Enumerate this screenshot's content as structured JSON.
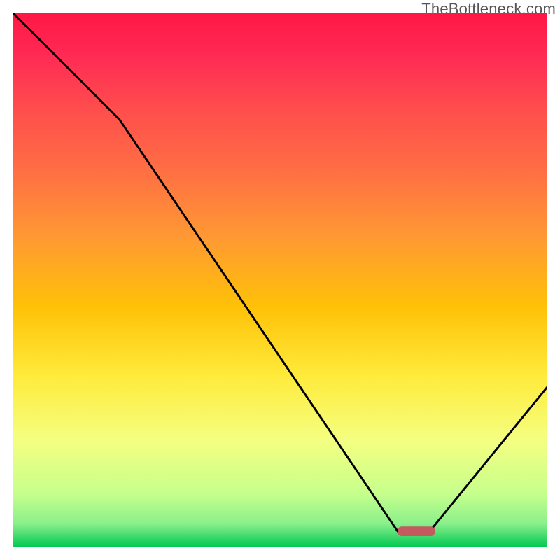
{
  "attribution": "TheBottleneck.com",
  "chart_data": {
    "type": "line",
    "title": "",
    "xlabel": "",
    "ylabel": "",
    "xlim": [
      0,
      100
    ],
    "ylim": [
      0,
      100
    ],
    "x": [
      0,
      20,
      72,
      78,
      100
    ],
    "y": [
      100,
      80,
      3,
      3,
      30
    ],
    "marker": {
      "x_center": 75.5,
      "y": 3,
      "width": 7,
      "height": 1.8,
      "color": "#c45a5f"
    },
    "gradient_stops": [
      {
        "offset": 0.0,
        "color": "#ff1744"
      },
      {
        "offset": 0.08,
        "color": "#ff2a55"
      },
      {
        "offset": 0.18,
        "color": "#ff4d4d"
      },
      {
        "offset": 0.3,
        "color": "#ff7043"
      },
      {
        "offset": 0.42,
        "color": "#ff9933"
      },
      {
        "offset": 0.55,
        "color": "#ffc107"
      },
      {
        "offset": 0.68,
        "color": "#ffeb3b"
      },
      {
        "offset": 0.8,
        "color": "#f4ff81"
      },
      {
        "offset": 0.9,
        "color": "#c6ff8c"
      },
      {
        "offset": 0.955,
        "color": "#8bf08b"
      },
      {
        "offset": 1.0,
        "color": "#00c853"
      }
    ],
    "curve_color": "#000000",
    "curve_width": 3
  }
}
